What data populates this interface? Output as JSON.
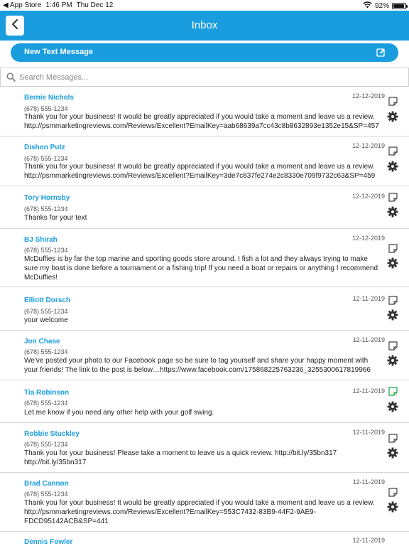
{
  "status_bar": {
    "back_app": "◀ App Store",
    "time": "1:46 PM",
    "date": "Thu Dec 12",
    "battery": "92%",
    "battery_level": 0.92
  },
  "header": {
    "title": "Inbox"
  },
  "new_message": {
    "label": "New Text Message"
  },
  "search": {
    "placeholder": "Search Messages..."
  },
  "colors": {
    "accent": "#1a9ddf",
    "note_unread": "#1aa33c"
  },
  "messages": [
    {
      "name": "Bernie Nichols",
      "phone": "(678) 555-1234",
      "date": "12-12-2019",
      "body": "Thank you for your business! It would be greatly appreciated if you would take a moment and leave us a review. http://psmmarketingreviews.com/Reviews/Excellent?EmailKey=aab68639a7cc43c8b8632893e1352e15&SP=457"
    },
    {
      "name": "Dishon Putz",
      "phone": "(678) 555-1234",
      "date": "12-12-2019",
      "body": "Thank you for your business! It would be greatly appreciated if you would take a moment and leave us a review. http://psmmarketingreviews.com/Reviews/Excellent?EmailKey=3de7c837fe274e2c8330e709f9732c63&SP=459"
    },
    {
      "name": "Tory Hornsby",
      "phone": "(678) 555-1234",
      "date": "12-12-2019",
      "body": "Thanks for your text"
    },
    {
      "name": "BJ Shirah",
      "phone": "(678) 555-1234",
      "date": "12-12-2019",
      "body": "McDuffies is by far the top marine and sporting goods store around. I fish a lot and they always trying to make sure my boat is done before a tournament or a fishing trip! If you need a boat or repairs or anything I recommend McDuffies!"
    },
    {
      "name": "Elliott Dorsch",
      "phone": "(678) 555-1234",
      "date": "12-11-2019",
      "body": "your welcome"
    },
    {
      "name": "Jon Chase",
      "phone": "(678) 555-1234",
      "date": "12-11-2019",
      "body": "We've posted your photo to our Facebook page so be sure to tag yourself and share your happy moment with your friends! The link to the post is below…https://www.facebook.com/175868225763236_3255300617819966"
    },
    {
      "name": "Tia Robinson",
      "phone": "(678) 555-1234",
      "date": "12-11-2019",
      "body": "Let me know if you need any other help with your golf swing."
    },
    {
      "name": "Robbie Stuckley",
      "phone": "(678) 555-1234",
      "date": "12-11-2019",
      "body": "Thank you for your business! Please take a moment to leave us a quick review. http://bit.ly/35bn317 http://bit.ly/35bn317"
    },
    {
      "name": "Brad Cannon",
      "phone": "(678) 555-1234",
      "date": "12-11-2019",
      "body": "Thank you for your business! It would be greatly appreciated if you would take a moment and leave us a review. http://psmmarketingreviews.com/Reviews/Excellent?EmailKey=553C7432-83B9-44F2-9AE9-FDCD95142ACB&SP=441"
    },
    {
      "name": "Dennis Fowler",
      "phone": "",
      "date": "12-11-2019",
      "body": ""
    }
  ]
}
